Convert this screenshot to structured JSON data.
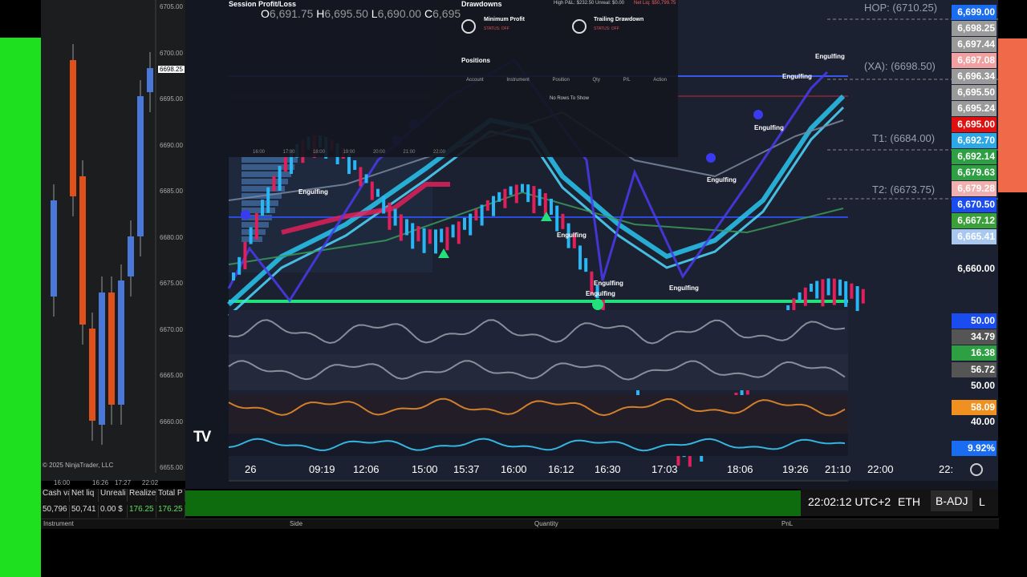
{
  "ninja_chart": {
    "price_ticks": [
      "6705.00",
      "6700.00",
      "6695.00",
      "6690.00",
      "6685.00",
      "6680.00",
      "6675.00",
      "6670.00",
      "6665.00",
      "6660.00",
      "6655.00"
    ],
    "current_price": "6698.25",
    "copyright": "© 2025 NinjaTrader, LLC",
    "time_ticks": [
      "16:00",
      "16:26",
      "17:27",
      "22:02"
    ]
  },
  "account": {
    "headers": [
      "Cash va",
      "Net liq",
      "Unreali",
      "Realize",
      "Total P"
    ],
    "values": [
      "50,796",
      "50,741",
      "0.00 $",
      "176.25",
      "176.25"
    ]
  },
  "grid_headers": [
    "Instrument",
    "Side",
    "Quantity",
    "PnL"
  ],
  "ohlc": {
    "O": "6,691.75",
    "H": "6,695.50",
    "L": "6,690.00",
    "C": "6,695"
  },
  "panel": {
    "session_title": "Session Profit/Loss",
    "drawdowns_title": "Drawdowns",
    "high_pnl": "High P&L: $232.50",
    "unreal": "Unreal: $0.00",
    "net_liq": "Net Liq: $50,799.75",
    "min_profit": "Minimum Profit",
    "trailing_drawdown": "Trailing Drawdown",
    "status_off": "STATUS: OFF",
    "positions_title": "Positions",
    "pos_cols": [
      "Account",
      "Instrument",
      "Position",
      "Qty",
      "P/L",
      "Action"
    ],
    "no_rows": "No Rows To Show",
    "mini_times": [
      "16:00",
      "17:00",
      "18:00",
      "19:00",
      "20:00",
      "21:00",
      "22:00"
    ]
  },
  "levels": {
    "hop": "HOP: (6710.25)",
    "xa": "(XA): (6698.50)",
    "t1": "T1: (6684.00)",
    "t2": "T2: (6673.75)"
  },
  "price_tags": [
    {
      "text": "6,699.00",
      "color": "#1a6cf0"
    },
    {
      "text": "6,698.25",
      "color": "#9a9a9a"
    },
    {
      "text": "6,697.44",
      "color": "#9a9a9a"
    },
    {
      "text": "6,697.08",
      "color": "#f0a0a0"
    },
    {
      "text": "6,696.34",
      "color": "#9a9a9a"
    },
    {
      "text": "6,695.50",
      "color": "#9a9a9a"
    },
    {
      "text": "6,695.24",
      "color": "#9a9a9a"
    },
    {
      "text": "6,695.00",
      "color": "#e01010"
    },
    {
      "text": "6,692.70",
      "color": "#2da8e6"
    },
    {
      "text": "6,692.14",
      "color": "#2ea043"
    },
    {
      "text": "6,679.63",
      "color": "#2ea043"
    },
    {
      "text": "6,679.28",
      "color": "#f0b0b0"
    },
    {
      "text": "6,670.50",
      "color": "#1a4cf0"
    },
    {
      "text": "6,667.12",
      "color": "#3aa03a"
    },
    {
      "text": "6,665.41",
      "color": "#a8c8f0"
    },
    {
      "text": "6,660.00",
      "color": "transparent"
    }
  ],
  "indicator_tags": [
    {
      "text": "50.00",
      "color": "#1a4cf0"
    },
    {
      "text": "34.79",
      "color": "#555"
    },
    {
      "text": "16.38",
      "color": "#2ea043"
    },
    {
      "text": "56.72",
      "color": "#555"
    },
    {
      "text": "50.00",
      "color": "transparent"
    },
    {
      "text": "58.09",
      "color": "#f09020"
    },
    {
      "text": "40.00",
      "color": "transparent"
    },
    {
      "text": "9.92%",
      "color": "#1a6cf0"
    }
  ],
  "time_axis": [
    "26",
    "09:19",
    "12:06",
    "15:00",
    "15:37",
    "16:00",
    "16:12",
    "16:30",
    "17:03",
    "18:06",
    "19:26",
    "21:10",
    "22:00",
    "22:"
  ],
  "engulfing_label": "Engulfing",
  "status_bar": {
    "clock": "22:02:12 UTC+2",
    "session": "ETH",
    "adj": "B-ADJ",
    "scale": "L"
  },
  "logo": "TV",
  "colors": {
    "accent_green": "#1fe01f",
    "accent_orange": "#f06a4a",
    "cyan": "#29c6f0",
    "magenta": "#e0205a"
  }
}
